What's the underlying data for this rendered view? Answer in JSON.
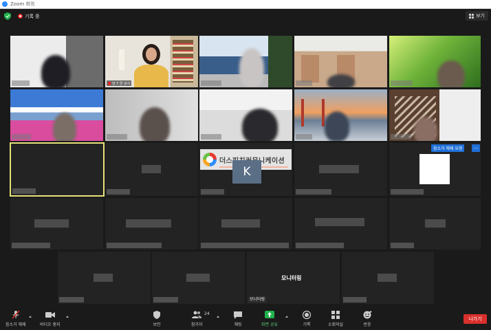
{
  "window": {
    "title": "Zoom 회의"
  },
  "status": {
    "recording_label": "기록 중"
  },
  "view_button": {
    "label": "보기"
  },
  "watermark": {
    "text": "더스피치커뮤니케이션"
  },
  "tiles": {
    "k_avatar_letter": "K",
    "mute_request_label": "음소거 해제 요청",
    "more_label": "···",
    "host_name": "당 Y 연 강사",
    "monitor_center": "모니터링",
    "monitor_chip": "모니터링"
  },
  "toolbar": {
    "unmute": "음소거 해제",
    "stop_video": "비디오 중지",
    "security": "보안",
    "participants": "참가자",
    "participants_count": "24",
    "chat": "채팅",
    "share_screen": "화면 공유",
    "record": "기록",
    "breakout": "소회의실",
    "reactions": "반응",
    "leave": "나가기"
  },
  "colors": {
    "accent": "#2d8cff",
    "share_green": "#23b14d",
    "leave_red": "#d9302c",
    "active_border": "#e8e37a"
  }
}
